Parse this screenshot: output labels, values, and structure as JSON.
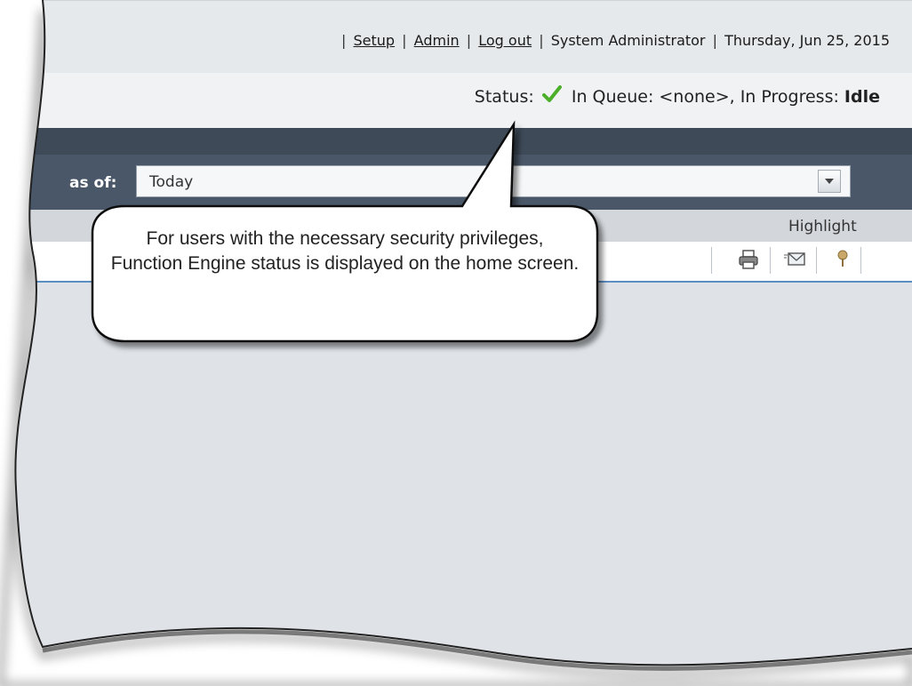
{
  "header": {
    "links": [
      {
        "label": "Setup"
      },
      {
        "label": "Admin"
      },
      {
        "label": "Log out"
      }
    ],
    "user": "System Administrator",
    "date": "Thursday, Jun 25, 2015"
  },
  "status": {
    "label": "Status:",
    "icon": "green-check-icon",
    "queue_text": "In Queue: <none>, In Progress:",
    "progress_value": "Idle"
  },
  "filter": {
    "label": "as of:",
    "value": "Today"
  },
  "panel": {
    "highlight_label": "Highlight",
    "tools": [
      "printer-icon",
      "email-icon",
      "pin-icon"
    ]
  },
  "callout": {
    "text": "For users with the necessary security privileges, Function Engine status is displayed on the home screen."
  },
  "colors": {
    "dark_band": "#3e4a58",
    "filter_row": "#4a5768",
    "content_bg": "#dfe3e8",
    "accent_line": "#5b8fc1",
    "check_green": "#4caf2a"
  }
}
